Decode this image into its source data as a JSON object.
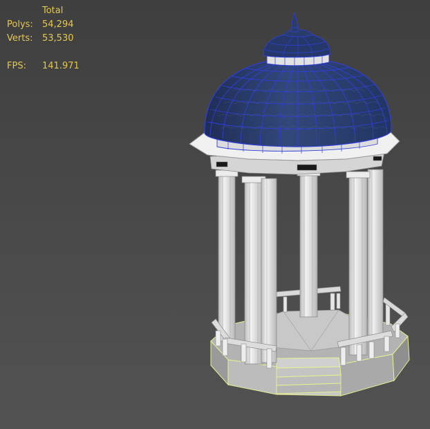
{
  "viewport": {
    "background_color": "#474747",
    "model_name": "gazebo-rotunda"
  },
  "stats": {
    "header": "Total",
    "polys_label": "Polys:",
    "polys_value": "54,294",
    "verts_label": "Verts:",
    "verts_value": "53,530",
    "fps_label": "FPS:",
    "fps_value": "141.971",
    "text_color": "#e6c84a"
  },
  "colors": {
    "dome_fill": "#2a3c6a",
    "dome_wire": "#2f3fd8",
    "column_fill": "#e2e2e2",
    "column_edge": "#8a8a8a",
    "selection_edge": "#e8f090"
  }
}
